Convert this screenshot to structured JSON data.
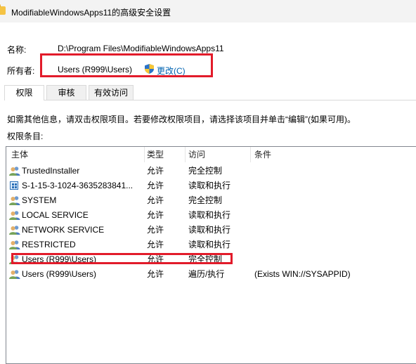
{
  "window": {
    "title": "ModifiableWindowsApps11的高级安全设置"
  },
  "info": {
    "name_label": "名称:",
    "name_value": "D:\\Program Files\\ModifiableWindowsApps11",
    "owner_label": "所有者:",
    "owner_value": "Users (R999\\Users)",
    "change_label": "更改(C)"
  },
  "tabs": [
    {
      "label": "权限",
      "active": true
    },
    {
      "label": "审核",
      "active": false
    },
    {
      "label": "有效访问",
      "active": false
    }
  ],
  "hint": "如需其他信息，请双击权限项目。若要修改权限项目，请选择该项目并单击“编辑”(如果可用)。",
  "entries_label": "权限条目:",
  "table": {
    "headers": [
      "主体",
      "类型",
      "访问",
      "条件"
    ],
    "rows": [
      {
        "principal": "TrustedInstaller",
        "type": "允许",
        "access": "完全控制",
        "condition": "",
        "icon": "user-group-icon"
      },
      {
        "principal": "S-1-15-3-1024-3635283841...",
        "type": "允许",
        "access": "读取和执行",
        "condition": "",
        "icon": "sid-icon"
      },
      {
        "principal": "SYSTEM",
        "type": "允许",
        "access": "完全控制",
        "condition": "",
        "icon": "user-group-icon"
      },
      {
        "principal": "LOCAL SERVICE",
        "type": "允许",
        "access": "读取和执行",
        "condition": "",
        "icon": "user-group-icon"
      },
      {
        "principal": "NETWORK SERVICE",
        "type": "允许",
        "access": "读取和执行",
        "condition": "",
        "icon": "user-group-icon"
      },
      {
        "principal": "RESTRICTED",
        "type": "允许",
        "access": "读取和执行",
        "condition": "",
        "icon": "user-group-icon"
      },
      {
        "principal": "Users (R999\\Users)",
        "type": "允许",
        "access": "完全控制",
        "condition": "",
        "icon": "user-group-icon"
      },
      {
        "principal": "Users (R999\\Users)",
        "type": "允许",
        "access": "遍历/执行",
        "condition": "(Exists WIN://SYSAPPID)",
        "icon": "user-group-icon"
      }
    ]
  },
  "colors": {
    "highlight": "#e21b2a",
    "link": "#0063b1"
  }
}
